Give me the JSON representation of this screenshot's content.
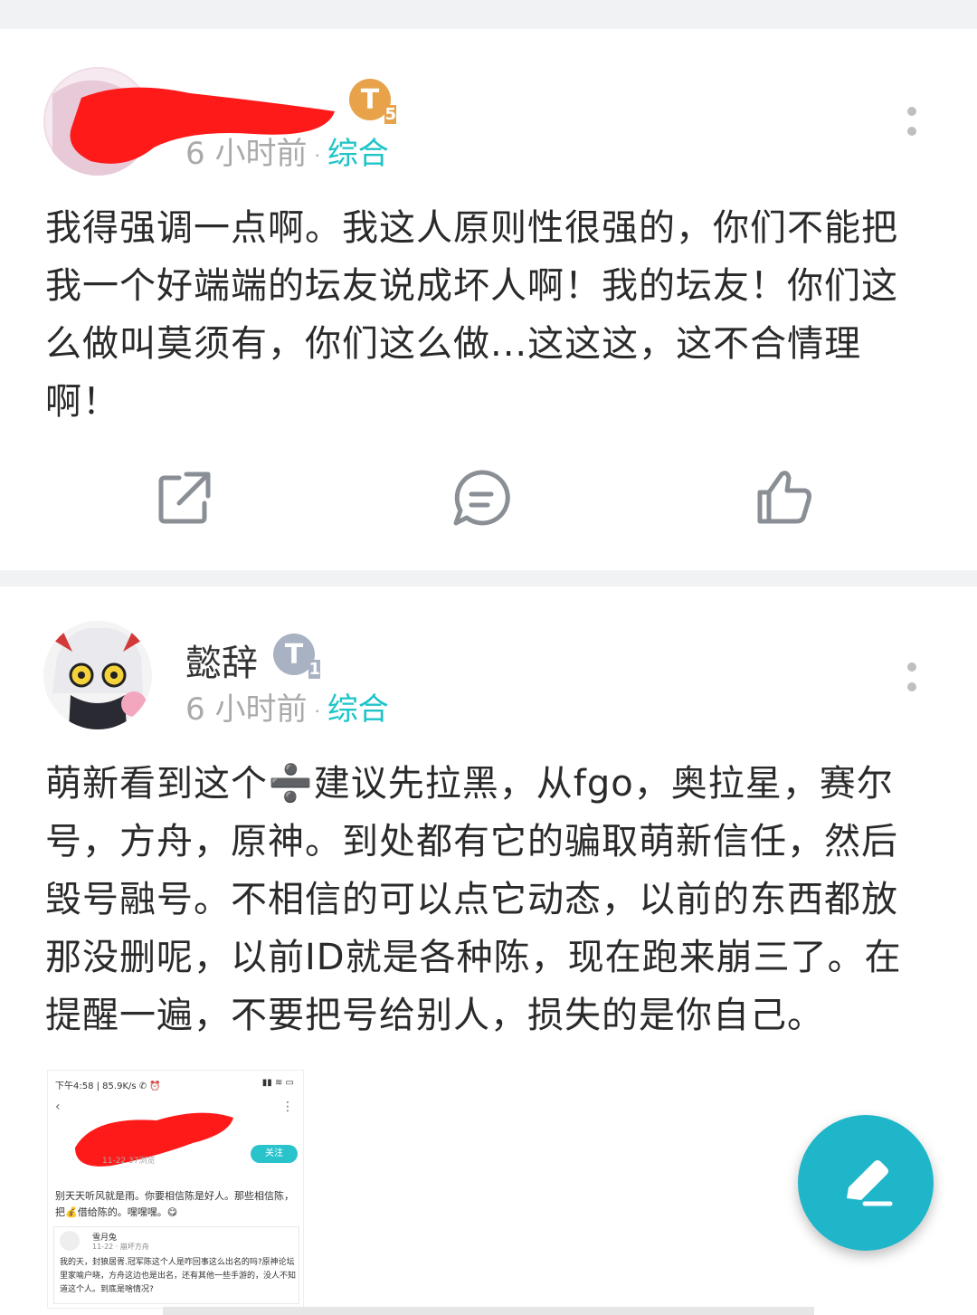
{
  "posts": [
    {
      "author": "",
      "level": "T",
      "level_num": "5",
      "time": "6 小时前",
      "category": "综合",
      "content": "我得强调一点啊。我这人原则性很强的，你们不能把我一个好端端的坛友说成坏人啊！我的坛友！你们这么做叫莫须有，你们这么做...这这这，这不合情理啊！"
    },
    {
      "author": "懿辞",
      "level": "T",
      "level_num": "1",
      "time": "6 小时前",
      "category": "综合",
      "content": "萌新看到这个➗建议先拉黑，从fgo，奥拉星，赛尔号，方舟，原神。到处都有它的骗取萌新信任，然后毁号融号。不相信的可以点它动态，以前的东西都放那没删呢，以前ID就是各种陈，现在跑来崩三了。在提醒一遍，不要把号给别人，损失的是你自己。"
    }
  ],
  "embedded_screenshot": {
    "status_left": "下午4:58 | 85.9K/s ✆ ⏰",
    "status_right": "▮▮ ≋ ▭",
    "follow_label": "关注",
    "meta": "11-22  37浏览",
    "text": "别天天听风就是雨。你要相信陈是好人。那些相信陈，把💰借给陈的。嘿嘿嘿。😋",
    "quote_user": "雪月兔",
    "quote_meta": "11-22 · 崩坏方舟",
    "quote_text": "我的天，封狼居胥.冠军陈这个人是咋回事这么出名的吗?原神论坛里家喻户晓，方舟这边也是出名，还有其他一些手游的，没人不知道这个人。到底是啥情况?"
  },
  "icons": {
    "share": "share-icon",
    "comment": "comment-icon",
    "like": "thumbs-up-icon",
    "compose": "compose-pen-icon"
  },
  "colors": {
    "accent": "#1ec4c8",
    "fab": "#1fb6c9",
    "badge_gold": "#e8a24a",
    "badge_silver": "#a9b2c2",
    "separator": "#f1f2f4"
  }
}
